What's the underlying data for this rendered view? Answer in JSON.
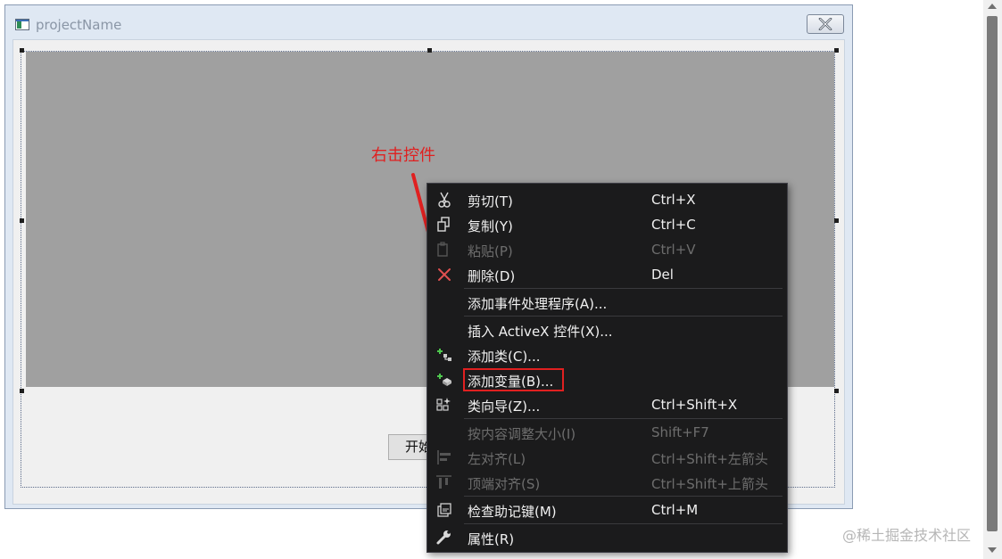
{
  "window": {
    "title": "projectName",
    "start_button_label": "开始"
  },
  "annotation": {
    "text": "右击控件",
    "color": "#e02020"
  },
  "context_menu": {
    "items": [
      {
        "label": "剪切(T)",
        "shortcut": "Ctrl+X",
        "icon": "scissors-icon",
        "disabled": false
      },
      {
        "label": "复制(Y)",
        "shortcut": "Ctrl+C",
        "icon": "copy-icon",
        "disabled": false
      },
      {
        "label": "粘贴(P)",
        "shortcut": "Ctrl+V",
        "icon": "paste-icon",
        "disabled": true
      },
      {
        "label": "删除(D)",
        "shortcut": "Del",
        "icon": "delete-icon",
        "disabled": false
      },
      {
        "label": "添加事件处理程序(A)...",
        "shortcut": "",
        "icon": "",
        "disabled": false
      },
      {
        "label": "插入 ActiveX 控件(X)...",
        "shortcut": "",
        "icon": "",
        "disabled": false
      },
      {
        "label": "添加类(C)...",
        "shortcut": "",
        "icon": "add-class-icon",
        "disabled": false
      },
      {
        "label": "添加变量(B)...",
        "shortcut": "",
        "icon": "add-variable-icon",
        "disabled": false
      },
      {
        "label": "类向导(Z)...",
        "shortcut": "Ctrl+Shift+X",
        "icon": "class-wizard-icon",
        "disabled": false
      },
      {
        "label": "按内容调整大小(I)",
        "shortcut": "Shift+F7",
        "icon": "",
        "disabled": true
      },
      {
        "label": "左对齐(L)",
        "shortcut": "Ctrl+Shift+左箭头",
        "icon": "align-left-icon",
        "disabled": true
      },
      {
        "label": "顶端对齐(S)",
        "shortcut": "Ctrl+Shift+上箭头",
        "icon": "align-top-icon",
        "disabled": true
      },
      {
        "label": "检查助记键(M)",
        "shortcut": "Ctrl+M",
        "icon": "check-mnemonics-icon",
        "disabled": false
      },
      {
        "label": "属性(R)",
        "shortcut": "",
        "icon": "wrench-icon",
        "disabled": false
      }
    ]
  },
  "watermark": "@稀土掘金技术社区",
  "colors": {
    "menu_background": "#1b1b1c",
    "highlight_border": "#e02020",
    "picture_control": "#a0a0a0"
  }
}
